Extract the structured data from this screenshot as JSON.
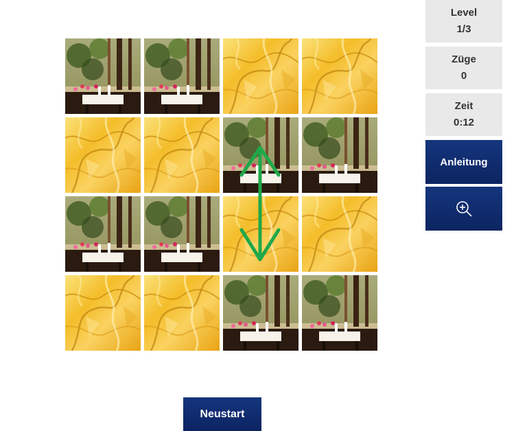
{
  "game": {
    "grid": [
      [
        "photo",
        "photo",
        "gold",
        "gold"
      ],
      [
        "gold",
        "gold",
        "photo",
        "photo"
      ],
      [
        "photo",
        "photo",
        "gold",
        "gold"
      ],
      [
        "gold",
        "gold",
        "photo",
        "photo"
      ]
    ],
    "hint_swap": {
      "from": [
        1,
        2
      ],
      "to": [
        2,
        2
      ],
      "color": "#1fa84a"
    }
  },
  "stats": {
    "level_label": "Level",
    "level_value": "1/3",
    "moves_label": "Züge",
    "moves_value": "0",
    "time_label": "Zeit",
    "time_value": "0:12"
  },
  "buttons": {
    "instructions": "Anleitung",
    "zoom_icon": "zoom-in-icon",
    "restart": "Neustart"
  },
  "colors": {
    "button_bg": "#0e2a6b",
    "stat_bg": "#e9e9e9",
    "gold": "#f3b820"
  }
}
